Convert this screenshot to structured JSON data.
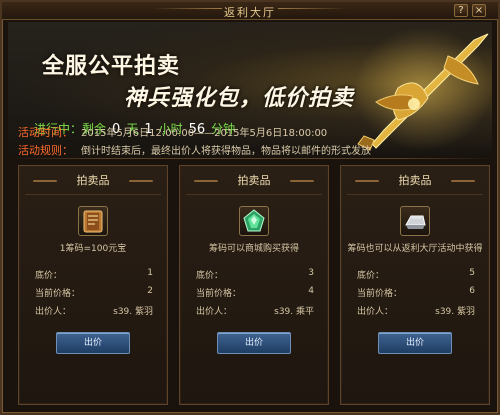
{
  "window": {
    "title": "返利大厅"
  },
  "titlebar": {
    "help_glyph": "?",
    "close_glyph": "×"
  },
  "banner": {
    "headline_1": "全服公平拍卖",
    "headline_2": "神兵强化包，低价拍卖",
    "countdown": {
      "prefix": "进行中：剩余",
      "days": "0",
      "days_unit": "天",
      "hours": "1",
      "hours_unit": "小时",
      "minutes": "56",
      "minutes_unit": "分钟"
    },
    "time_label": "活动时间：",
    "time_value": "2015年5月6日12:00:00——2015年5月6日18:00:00",
    "rules_label": "活动规则：",
    "rules_value": "倒计时结束后，最终出价人将获得物品，物品将以邮件的形式发放"
  },
  "cards": [
    {
      "header": "拍卖品",
      "icon": "scroll-book-icon",
      "description": "1筹码=100元宝",
      "base_label": "底价：",
      "base_value": "1",
      "current_label": "当前价格：",
      "current_value": "2",
      "bidder_label": "出价人：",
      "bidder_value": "s39. 紫羽",
      "button": "出价"
    },
    {
      "header": "拍卖品",
      "icon": "green-gem-icon",
      "description": "筹码可以商城购买获得",
      "base_label": "底价：",
      "base_value": "3",
      "current_label": "当前价格：",
      "current_value": "4",
      "bidder_label": "出价人：",
      "bidder_value": "s39. 乘平",
      "button": "出价"
    },
    {
      "header": "拍卖品",
      "icon": "silver-ingot-icon",
      "description": "筹码也可以从返利大厅活动中获得",
      "base_label": "底价：",
      "base_value": "5",
      "current_label": "当前价格：",
      "current_value": "6",
      "bidder_label": "出价人：",
      "bidder_value": "s39. 紫羽",
      "button": "出价"
    }
  ],
  "colors": {
    "accent_orange": "#ff6b2a",
    "countdown_green": "#7ce04a",
    "button_blue": "#2f5383",
    "gold": "#e7c98e"
  }
}
